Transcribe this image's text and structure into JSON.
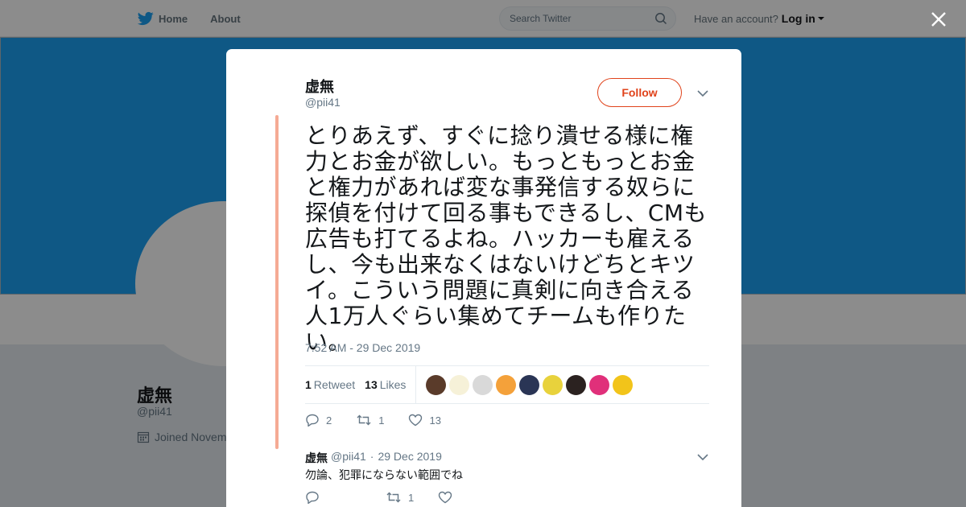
{
  "nav": {
    "home": "Home",
    "about": "About",
    "search_placeholder": "Search Twitter",
    "have_account": "Have an account?",
    "login": "Log in"
  },
  "background_profile": {
    "name": "虚無",
    "handle": "@pii41",
    "joined": "Joined Novem"
  },
  "tweet": {
    "author_name": "虚無",
    "author_handle": "@pii41",
    "follow_label": "Follow",
    "text": "とりあえず、すぐに捻り潰せる様に権力とお金が欲しい。もっともっとお金と権力があれば変な事発信する奴らに探偵を付けて回る事もできるし、CMも広告も打てるよね。ハッカーも雇えるし、今も出来なくはないけどちとキツイ。こういう問題に真剣に向き合える人1万人ぐらい集めてチームも作りたい。",
    "timestamp": "7:52 AM - 29 Dec 2019",
    "retweet_count": "1",
    "retweet_label": "Retweet",
    "like_count": "13",
    "like_label": "Likes",
    "actions": {
      "reply": "2",
      "retweet": "1",
      "like": "13"
    },
    "liker_avatar_colors": [
      "#5a3b2a",
      "#f6f1d8",
      "#d9d9d9",
      "#f4a13a",
      "#2a3555",
      "#e8d23c",
      "#2b2220",
      "#e0307a",
      "#f2c41a"
    ]
  },
  "reply": {
    "author_name": "虚無",
    "author_handle": "@pii41",
    "date": "29 Dec 2019",
    "text": "勿論、犯罪にならない範囲でね",
    "actions": {
      "reply": "",
      "retweet": "1",
      "like": ""
    }
  },
  "colors": {
    "accent": "#e0431b",
    "thread_line": "#f5aa94",
    "twitter_blue": "#1da1f2"
  }
}
